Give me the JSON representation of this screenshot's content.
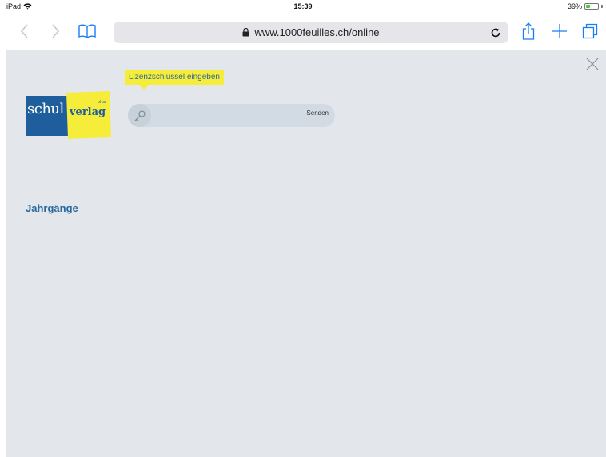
{
  "status": {
    "device": "iPad",
    "time": "15:39",
    "battery": "39%",
    "battery_level": 0.39
  },
  "browser": {
    "url": "www.1000feuilles.ch/online"
  },
  "colors": {
    "page_bg": "#e3e6ea",
    "brand_blue": "#1f5e9c",
    "brand_yellow": "#f6ec3a",
    "link_blue": "#2a6a9f"
  },
  "logo": {
    "part1": "schul",
    "part2": "verlag",
    "part3": "plus"
  },
  "license": {
    "tooltip": "Lizenzschlüssel eingeben",
    "placeholder": "",
    "submit_label": "Senden"
  },
  "main": {
    "heading": "Jahrgänge"
  }
}
